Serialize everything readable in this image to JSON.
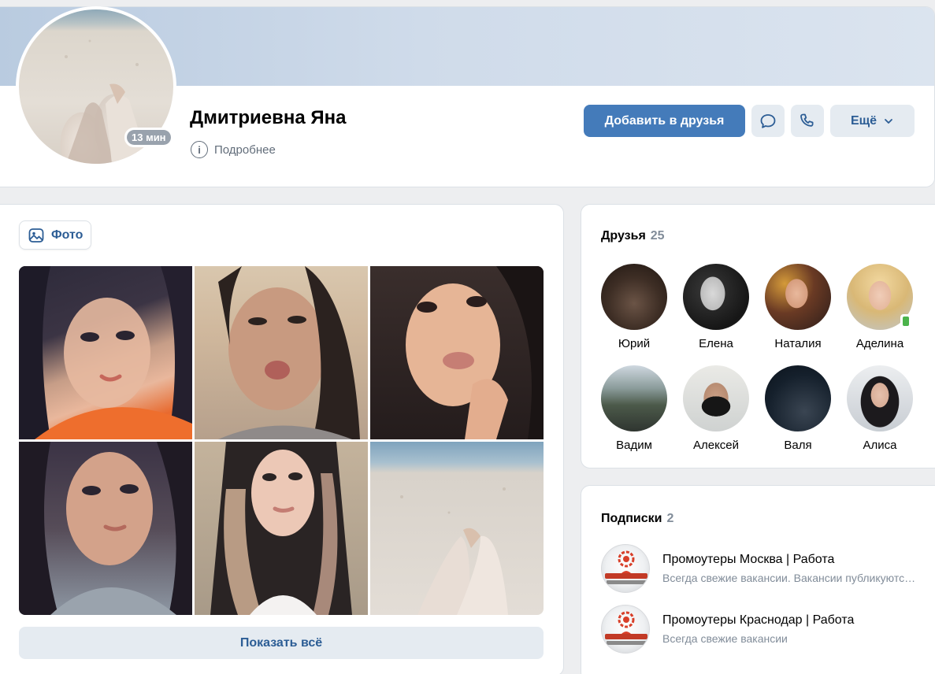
{
  "profile": {
    "name": "Дмитриевна Яна",
    "online_badge": "13 мин",
    "more_info": "Подробнее"
  },
  "actions": {
    "add_friend": "Добавить в друзья",
    "message_icon": "message-icon",
    "call_icon": "phone-icon",
    "more": "Ещё"
  },
  "photos": {
    "tab_label": "Фото",
    "show_all": "Показать всё",
    "count_shown": 6
  },
  "friends": {
    "title": "Друзья",
    "count": "25",
    "items": [
      {
        "name": "Юрий"
      },
      {
        "name": "Елена"
      },
      {
        "name": "Наталия"
      },
      {
        "name": "Аделина",
        "mobile": true
      },
      {
        "name": "Вадим"
      },
      {
        "name": "Алексей"
      },
      {
        "name": "Валя"
      },
      {
        "name": "Алиса"
      }
    ]
  },
  "subscriptions": {
    "title": "Подписки",
    "count": "2",
    "items": [
      {
        "name": "Промоутеры Москва | Работа",
        "desc": "Всегда свежие вакансии. Вакансии публикуются ежедневно"
      },
      {
        "name": "Промоутеры Краснодар | Работа",
        "desc": "Всегда свежие вакансии"
      }
    ]
  },
  "colors": {
    "accent": "#447bba",
    "link": "#2c5d95",
    "secondary_bg": "#e5ebf1",
    "muted_text": "#818c99",
    "page_bg": "#edeef0",
    "online_mobile": "#4bb34b"
  }
}
